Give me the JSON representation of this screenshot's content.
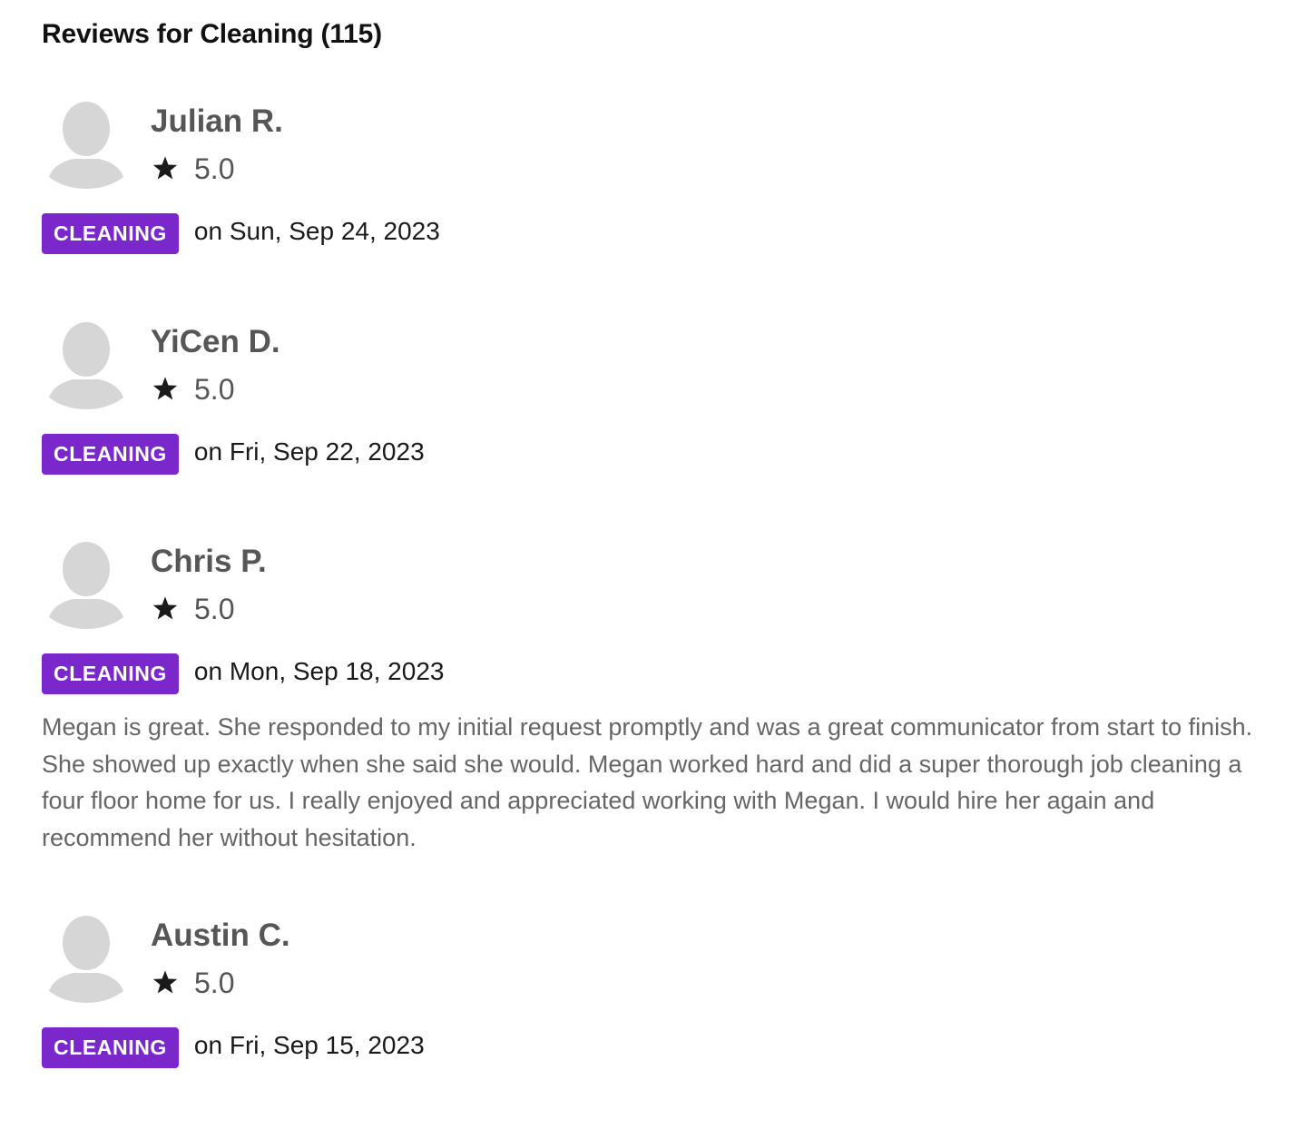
{
  "heading": "Reviews for Cleaning (115)",
  "icons": {
    "avatar": "default-avatar-silhouette-icon",
    "star": "star-icon"
  },
  "colors": {
    "badge_background": "#7a28cc",
    "badge_text": "#ffffff",
    "avatar": "#d6d6d6",
    "star": "#1a1a1a",
    "name": "#565656",
    "body_text": "#666666"
  },
  "reviews": [
    {
      "name": "Julian R.",
      "rating": "5.0",
      "category": "CLEANING",
      "date": "on Sun, Sep 24, 2023",
      "text": ""
    },
    {
      "name": "YiCen D.",
      "rating": "5.0",
      "category": "CLEANING",
      "date": "on Fri, Sep 22, 2023",
      "text": ""
    },
    {
      "name": "Chris P.",
      "rating": "5.0",
      "category": "CLEANING",
      "date": "on Mon, Sep 18, 2023",
      "text": "Megan is great. She responded to my initial request promptly and was a great communicator from start to finish. She showed up exactly when she said she would. Megan worked hard and did a super thorough job cleaning a four floor home for us. I really enjoyed and appreciated working with Megan. I would hire her again and recommend her without hesitation."
    },
    {
      "name": "Austin C.",
      "rating": "5.0",
      "category": "CLEANING",
      "date": "on Fri, Sep 15, 2023",
      "text": ""
    }
  ]
}
